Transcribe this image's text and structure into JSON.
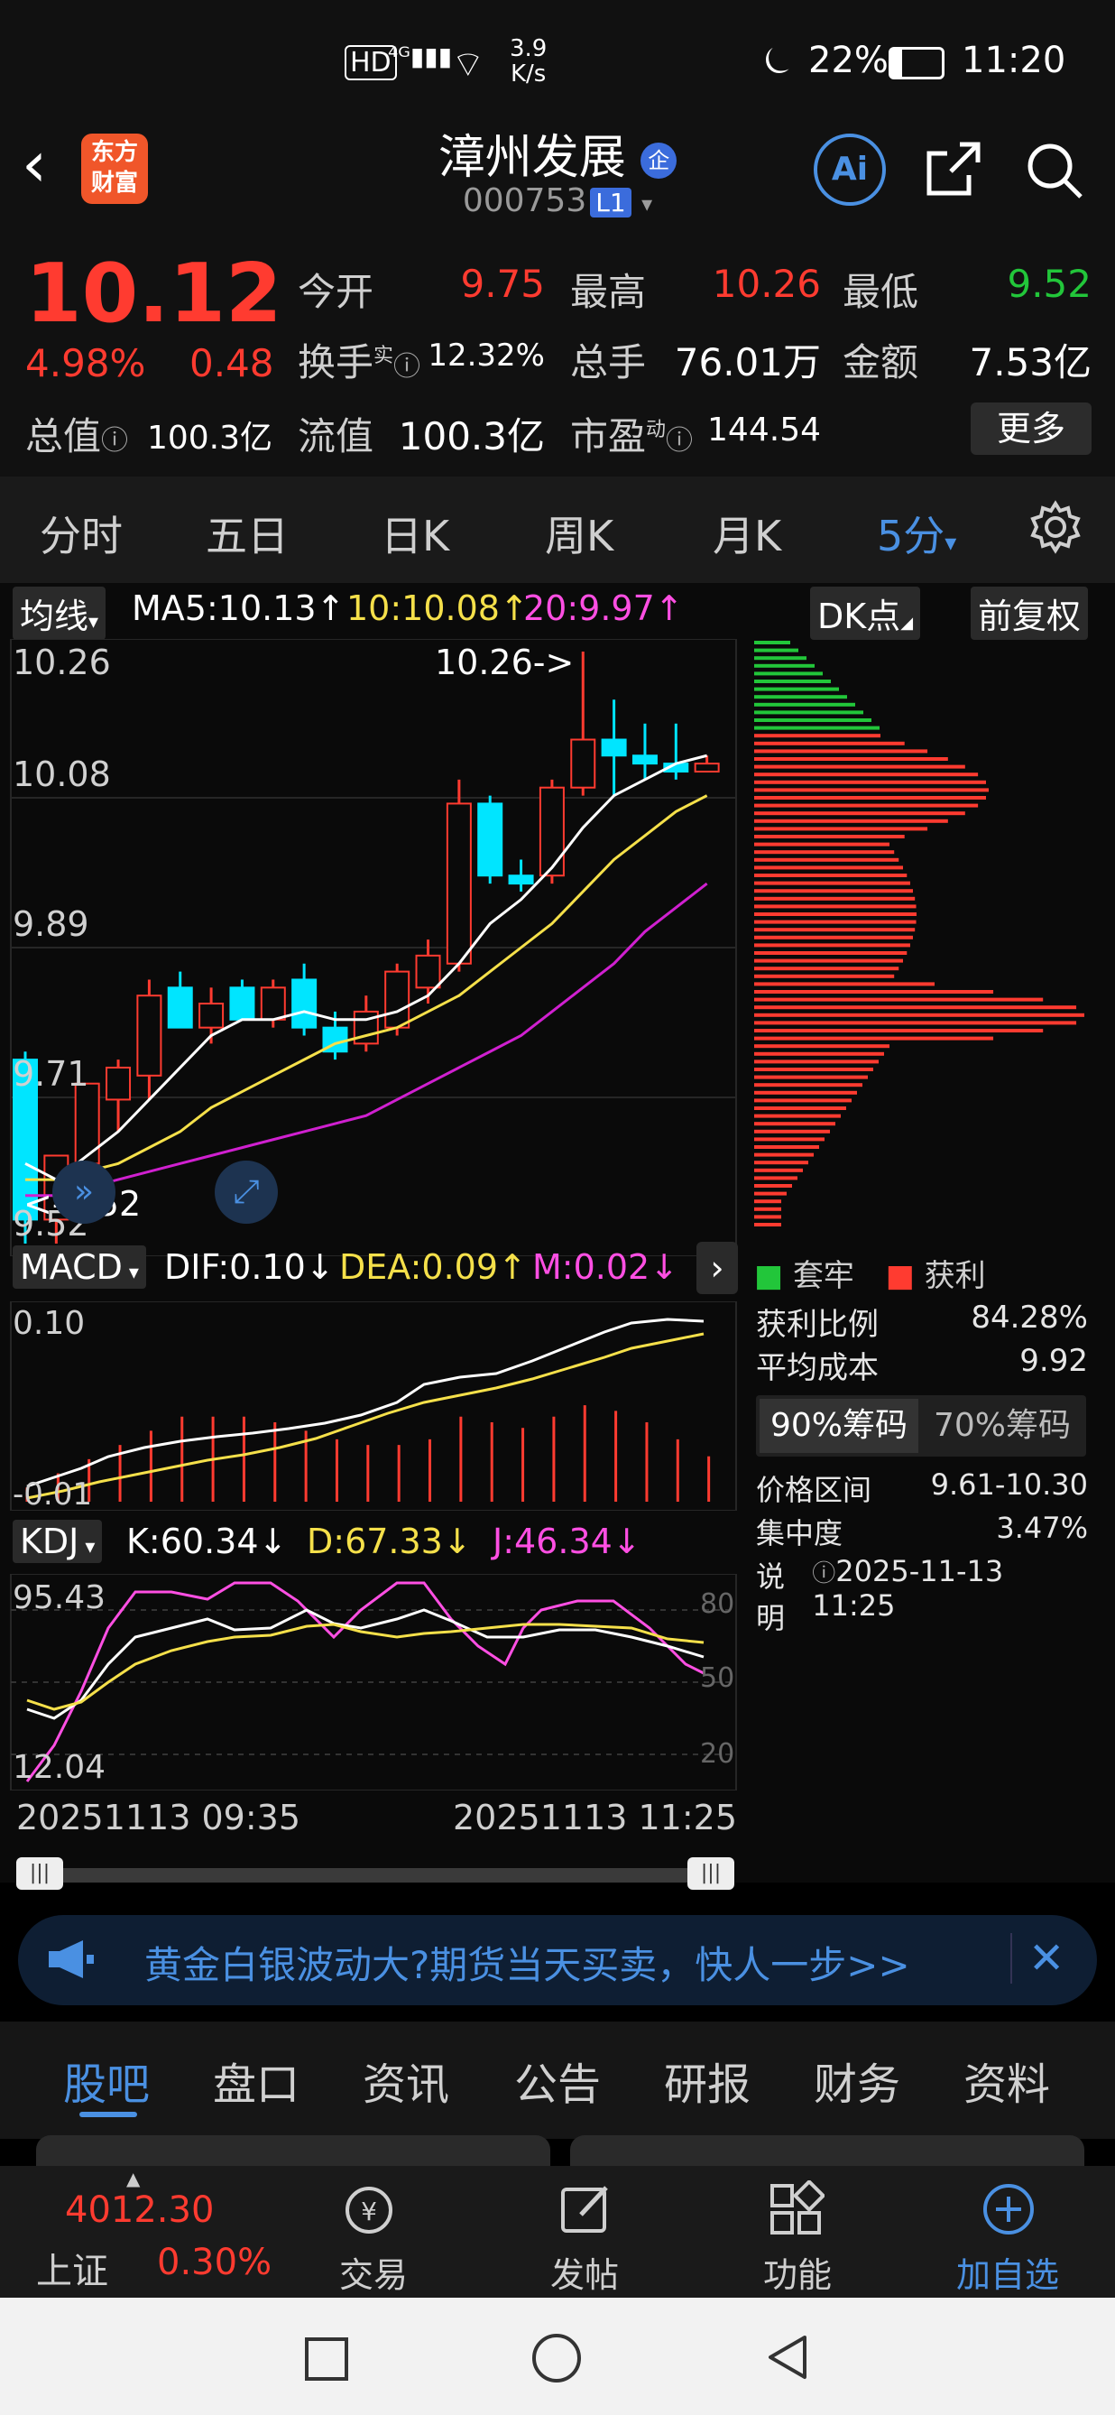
{
  "status_bar": {
    "net_speed_value": "3.9",
    "net_speed_unit": "K/s",
    "battery": "22%",
    "time": "11:20"
  },
  "header": {
    "title": "漳州发展",
    "badge": "企",
    "code": "000753",
    "level": "L1",
    "logo_line1": "东方",
    "logo_line2": "财富",
    "ai_label": "Ai"
  },
  "quote": {
    "price": "10.12",
    "change_pct": "4.98%",
    "change": "0.48",
    "open_label": "今开",
    "open": "9.75",
    "high_label": "最高",
    "high": "10.26",
    "low_label": "最低",
    "low": "9.52",
    "turnover_label": "换手",
    "turnover_sup": "实",
    "turnover": "12.32%",
    "volume_label": "总手",
    "volume": "76.01万",
    "amount_label": "金额",
    "amount": "7.53亿",
    "mktcap_label": "总值",
    "mktcap": "100.3亿",
    "float_label": "流值",
    "float": "100.3亿",
    "pe_label": "市盈",
    "pe_sup": "动",
    "pe": "144.54",
    "more_button": "更多"
  },
  "ktabs": [
    "分时",
    "五日",
    "日K",
    "周K",
    "月K",
    "5分"
  ],
  "main_chart": {
    "indicator": "均线",
    "ma5": "MA5:10.13↑",
    "ma10": "10:10.08↑",
    "ma20": "20:9.97↑",
    "dk_button": "DK点",
    "adjust_button": "前复权",
    "price_labels": [
      "10.26",
      "10.08",
      "9.89",
      "9.71",
      "9.52"
    ],
    "high_marker": "10.26->",
    "low_marker": "<-9.52"
  },
  "chart_data": {
    "type": "candlestick",
    "ylim": [
      9.52,
      10.26
    ],
    "candles": [
      {
        "o": 9.75,
        "h": 9.76,
        "l": 9.52,
        "c": 9.55
      },
      {
        "o": 9.55,
        "h": 9.63,
        "l": 9.52,
        "c": 9.63
      },
      {
        "o": 9.62,
        "h": 9.72,
        "l": 9.6,
        "c": 9.72
      },
      {
        "o": 9.7,
        "h": 9.75,
        "l": 9.66,
        "c": 9.74
      },
      {
        "o": 9.73,
        "h": 9.85,
        "l": 9.7,
        "c": 9.83
      },
      {
        "o": 9.84,
        "h": 9.86,
        "l": 9.79,
        "c": 9.79
      },
      {
        "o": 9.79,
        "h": 9.84,
        "l": 9.77,
        "c": 9.82
      },
      {
        "o": 9.84,
        "h": 9.85,
        "l": 9.8,
        "c": 9.8
      },
      {
        "o": 9.8,
        "h": 9.85,
        "l": 9.79,
        "c": 9.84
      },
      {
        "o": 9.85,
        "h": 9.87,
        "l": 9.78,
        "c": 9.79
      },
      {
        "o": 9.79,
        "h": 9.81,
        "l": 9.75,
        "c": 9.76
      },
      {
        "o": 9.77,
        "h": 9.83,
        "l": 9.76,
        "c": 9.81
      },
      {
        "o": 9.79,
        "h": 9.87,
        "l": 9.78,
        "c": 9.86
      },
      {
        "o": 9.84,
        "h": 9.9,
        "l": 9.82,
        "c": 9.88
      },
      {
        "o": 9.87,
        "h": 10.1,
        "l": 9.86,
        "c": 10.07
      },
      {
        "o": 10.07,
        "h": 10.08,
        "l": 9.97,
        "c": 9.98
      },
      {
        "o": 9.98,
        "h": 10.0,
        "l": 9.96,
        "c": 9.97
      },
      {
        "o": 9.98,
        "h": 10.1,
        "l": 9.97,
        "c": 10.09
      },
      {
        "o": 10.09,
        "h": 10.26,
        "l": 10.08,
        "c": 10.15
      },
      {
        "o": 10.15,
        "h": 10.2,
        "l": 10.08,
        "c": 10.13
      },
      {
        "o": 10.13,
        "h": 10.17,
        "l": 10.1,
        "c": 10.12
      },
      {
        "o": 10.12,
        "h": 10.17,
        "l": 10.1,
        "c": 10.11
      },
      {
        "o": 10.11,
        "h": 10.13,
        "l": 10.11,
        "c": 10.12
      }
    ],
    "ma5_values": [
      9.62,
      9.6,
      9.63,
      9.66,
      9.7,
      9.74,
      9.78,
      9.8,
      9.8,
      9.81,
      9.8,
      9.8,
      9.81,
      9.83,
      9.87,
      9.92,
      9.95,
      9.99,
      10.04,
      10.08,
      10.1,
      10.12,
      10.13
    ],
    "ma10_values": [
      9.6,
      9.6,
      9.61,
      9.62,
      9.64,
      9.66,
      9.69,
      9.71,
      9.73,
      9.75,
      9.77,
      9.78,
      9.79,
      9.81,
      9.83,
      9.86,
      9.89,
      9.92,
      9.96,
      10.0,
      10.03,
      10.06,
      10.08
    ],
    "ma20_values": [
      9.58,
      9.58,
      9.59,
      9.6,
      9.61,
      9.62,
      9.63,
      9.64,
      9.65,
      9.66,
      9.67,
      9.68,
      9.7,
      9.72,
      9.74,
      9.76,
      9.78,
      9.81,
      9.84,
      9.87,
      9.91,
      9.94,
      9.97
    ],
    "x_start": "20251113 09:35",
    "x_end": "20251113 11:25"
  },
  "macd": {
    "label": "MACD",
    "dif": "DIF:0.10↓",
    "dea": "DEA:0.09↑",
    "m": "M:0.02↓",
    "axis_top": "0.10",
    "axis_bottom": "-0.01",
    "bars": [
      0.005,
      0.01,
      0.015,
      0.02,
      0.025,
      0.03,
      0.03,
      0.03,
      0.028,
      0.025,
      0.022,
      0.02,
      0.02,
      0.022,
      0.03,
      0.028,
      0.026,
      0.03,
      0.034,
      0.032,
      0.028,
      0.022,
      0.016
    ]
  },
  "kdj": {
    "label": "KDJ",
    "k": "K:60.34↓",
    "d": "D:67.33↓",
    "j": "J:46.34↓",
    "axis_top": "95.43",
    "axis_bottom": "12.04",
    "ref_80": "80",
    "ref_50": "50",
    "ref_20": "20"
  },
  "chips": {
    "legend_trapped": "套牢",
    "legend_profit": "获利",
    "rows": [
      {
        "label": "获利比例",
        "value": "84.28%"
      },
      {
        "label": "平均成本",
        "value": "9.92"
      }
    ],
    "tab_90": "90%筹码",
    "tab_70": "70%筹码",
    "rows2": [
      {
        "label": "价格区间",
        "value": "9.61-10.30"
      },
      {
        "label": "集中度",
        "value": "3.47%"
      },
      {
        "label": "说明",
        "value": "2025-11-13 11:25"
      }
    ]
  },
  "banner": {
    "text": "黄金白银波动大?期货当天买卖，快人一步>>"
  },
  "section_tabs": [
    "股吧",
    "盘口",
    "资讯",
    "公告",
    "研报",
    "财务",
    "资料"
  ],
  "bottom_nav": {
    "index_name": "上证",
    "index_value": "4012.30",
    "index_change": "0.30%",
    "items": [
      "交易",
      "发帖",
      "功能",
      "加自选"
    ]
  },
  "colors": {
    "up": "#ff3b30",
    "down": "#22c63a",
    "cyan": "#00e5ff",
    "accent": "#3b82f6"
  }
}
